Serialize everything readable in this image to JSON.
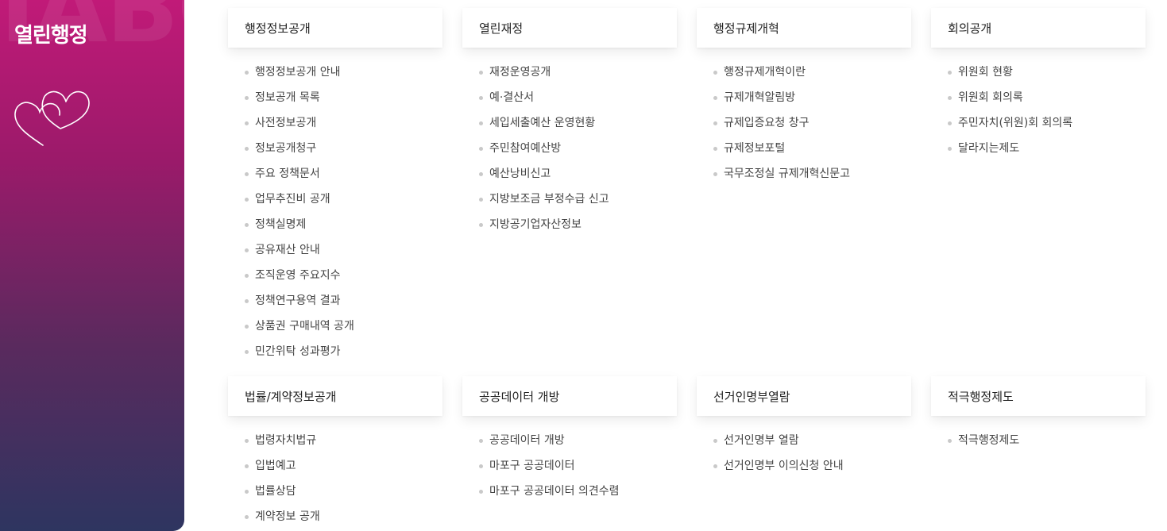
{
  "sidebar": {
    "watermark": "IABO",
    "title": "열린행정",
    "icon": "double-heart-icon"
  },
  "sections": [
    {
      "title": "행정정보공개",
      "items": [
        "행정정보공개 안내",
        "정보공개 목록",
        "사전정보공개",
        "정보공개청구",
        "주요 정책문서",
        "업무추진비 공개",
        "정책실명제",
        "공유재산 안내",
        "조직운영 주요지수",
        "정책연구용역 결과",
        "상품권 구매내역 공개",
        "민간위탁 성과평가"
      ]
    },
    {
      "title": "열린재정",
      "items": [
        "재정운영공개",
        "예·결산서",
        "세입세출예산 운영현황",
        "주민참여예산방",
        "예산낭비신고",
        "지방보조금 부정수급 신고",
        "지방공기업자산정보"
      ]
    },
    {
      "title": "행정규제개혁",
      "items": [
        "행정규제개혁이란",
        "규제개혁알림방",
        "규제입증요청 창구",
        "규제정보포털",
        "국무조정실 규제개혁신문고"
      ]
    },
    {
      "title": "회의공개",
      "items": [
        "위원회 현황",
        "위원회 회의록",
        "주민자치(위원)회 회의록",
        "달라지는제도"
      ]
    },
    {
      "title": "법률/계약정보공개",
      "items": [
        "법령자치법규",
        "입법예고",
        "법률상담",
        "계약정보 공개"
      ]
    },
    {
      "title": "공공데이터 개방",
      "items": [
        "공공데이터 개방",
        "마포구 공공데이터",
        "마포구 공공데이터 의견수렴"
      ]
    },
    {
      "title": "선거인명부열람",
      "items": [
        "선거인명부 열람",
        "선거인명부 이의신청 안내"
      ]
    },
    {
      "title": "적극행정제도",
      "items": [
        "적극행정제도"
      ]
    }
  ],
  "colors": {
    "sidebar_top": "#c11a78",
    "sidebar_bottom": "#2e3560",
    "bullet": "#c9c9c9"
  }
}
